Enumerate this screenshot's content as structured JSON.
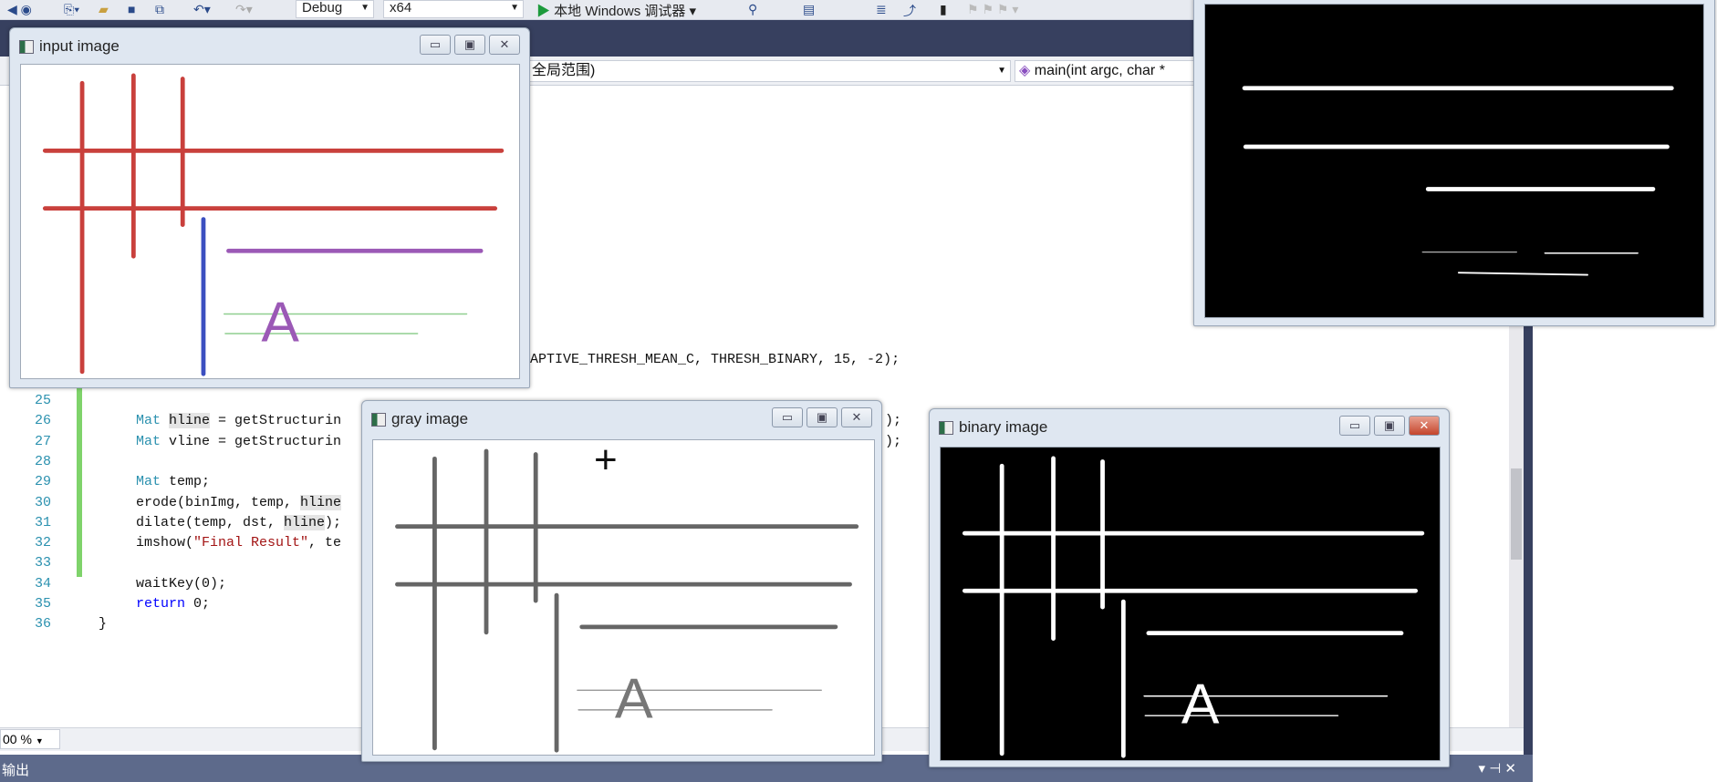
{
  "toolbar": {
    "config": "Debug",
    "platform": "x64",
    "run_label": "本地 Windows 调试器"
  },
  "navbar": {
    "scope": "全局范围)",
    "function": "main(int argc, char *"
  },
  "code": {
    "line24_tail": "APTIVE_THRESH_MEAN_C, THRESH_BINARY, 15, -2);",
    "lines": [
      {
        "n": "25",
        "parts": []
      },
      {
        "n": "26",
        "parts": [
          {
            "t": "Mat",
            "c": "ty"
          },
          {
            "t": " "
          },
          {
            "t": "hline",
            "c": "hl"
          },
          {
            "t": " = getStructurin"
          }
        ],
        "tail": ");"
      },
      {
        "n": "27",
        "parts": [
          {
            "t": "Mat",
            "c": "ty"
          },
          {
            "t": " vline = getStructurin"
          }
        ],
        "tail": ");"
      },
      {
        "n": "28",
        "parts": []
      },
      {
        "n": "29",
        "parts": [
          {
            "t": "Mat",
            "c": "ty"
          },
          {
            "t": " temp;"
          }
        ]
      },
      {
        "n": "30",
        "parts": [
          {
            "t": "erode(binImg, temp, "
          },
          {
            "t": "hline",
            "c": "hl"
          }
        ]
      },
      {
        "n": "31",
        "parts": [
          {
            "t": "dilate(temp, dst, "
          },
          {
            "t": "hline",
            "c": "hl"
          },
          {
            "t": ");"
          }
        ]
      },
      {
        "n": "32",
        "parts": [
          {
            "t": "imshow("
          },
          {
            "t": "\"Final Result\"",
            "c": "str"
          },
          {
            "t": ", te"
          }
        ]
      },
      {
        "n": "33",
        "parts": []
      },
      {
        "n": "34",
        "parts": [
          {
            "t": "waitKey(0);"
          }
        ]
      },
      {
        "n": "35",
        "parts": [
          {
            "t": "return",
            "c": "kw"
          },
          {
            "t": " 0;"
          }
        ]
      },
      {
        "n": "36",
        "parts": [
          {
            "t": "}"
          }
        ],
        "outdent": true
      }
    ]
  },
  "zoom": {
    "value": "00 %"
  },
  "output": {
    "title": "输出",
    "controls": "▾ ⊣ ✕"
  },
  "windows": {
    "input": {
      "title": "input image"
    },
    "gray": {
      "title": "gray image"
    },
    "binary": {
      "title": "binary image"
    }
  },
  "drawing": {
    "glyph": "A"
  },
  "colors": {
    "red": "#c9403c",
    "blue": "#3b4fc0",
    "purple": "#9b59b6",
    "green": "#8fcf8f",
    "gray": "#666666",
    "navy": "#37405f"
  }
}
